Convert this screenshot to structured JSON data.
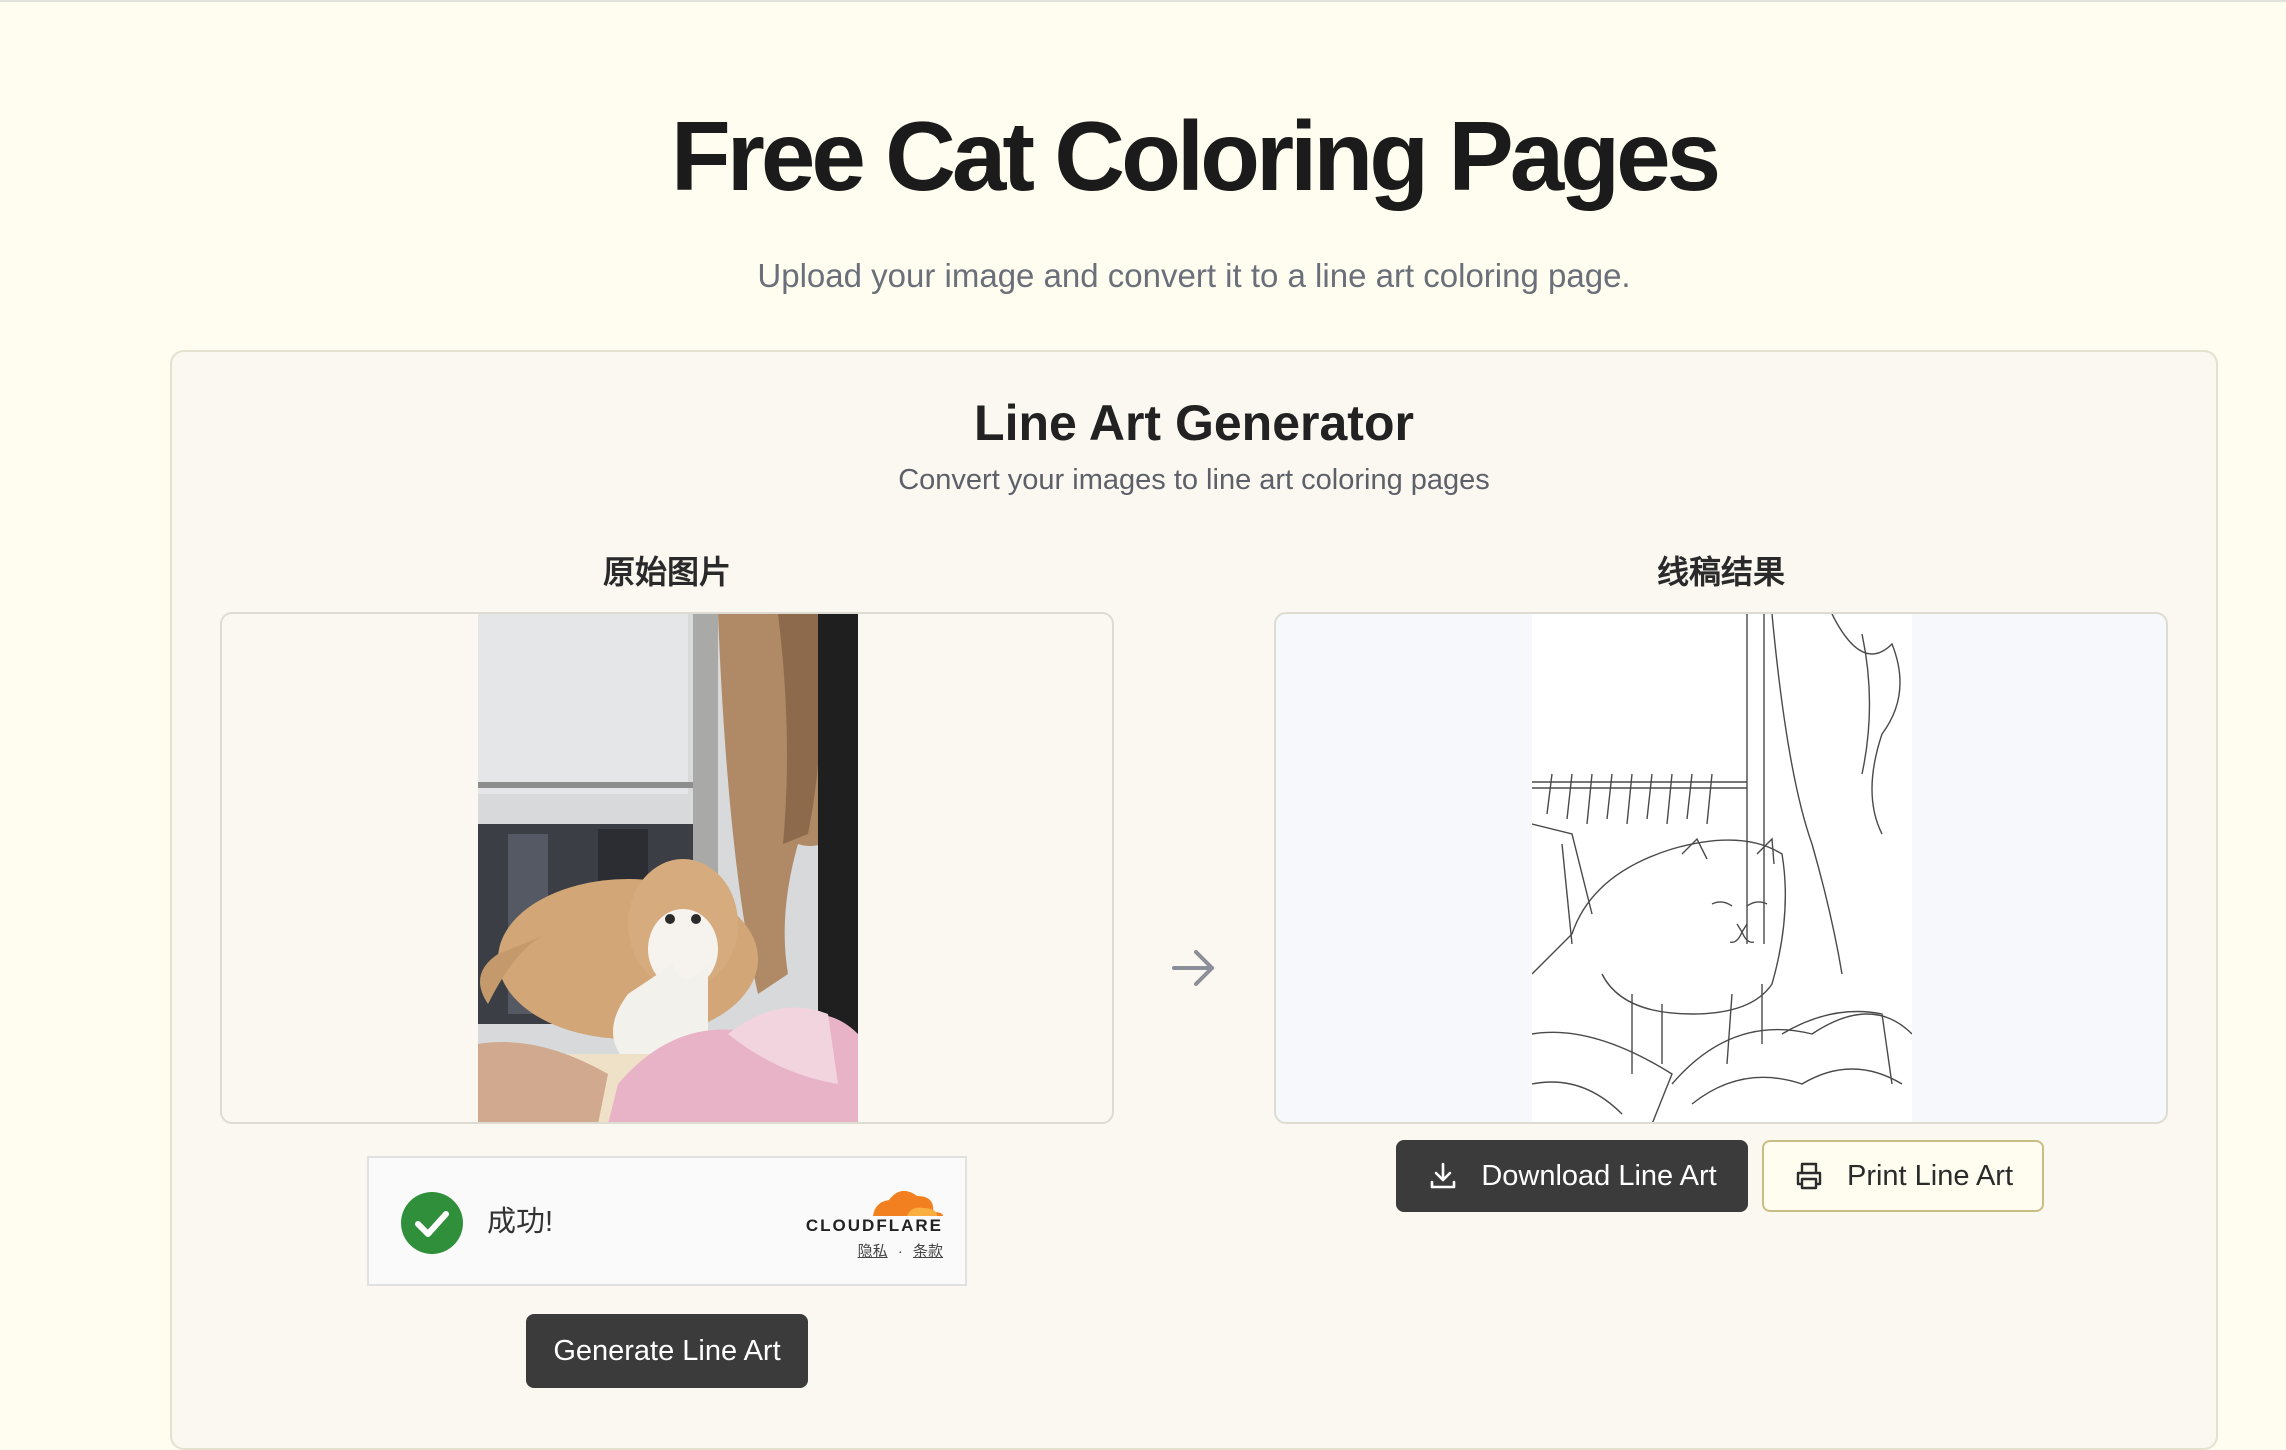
{
  "header": {
    "title": "Free Cat Coloring Pages",
    "subtitle": "Upload your image and convert it to a line art coloring page."
  },
  "generator": {
    "title": "Line Art Generator",
    "subtitle": "Convert your images to line art coloring pages",
    "original_label": "原始图片",
    "result_label": "线稿结果"
  },
  "captcha": {
    "status": "成功!",
    "brand": "CLOUDFLARE",
    "privacy_link": "隐私",
    "separator": "·",
    "terms_link": "条款"
  },
  "actions": {
    "generate_label": "Generate Line Art",
    "download_label": "Download Line Art",
    "print_label": "Print Line Art"
  },
  "icons": {
    "arrow": "arrow-right-icon",
    "check": "checkmark-icon",
    "download": "download-icon",
    "print": "printer-icon",
    "cloud": "cloudflare-cloud-icon"
  },
  "colors": {
    "page_background": "#fefdf0",
    "primary_button": "#3b3b3b",
    "success_green": "#2f8f3a",
    "cloudflare_orange": "#f38020",
    "print_border": "#c9be82"
  }
}
